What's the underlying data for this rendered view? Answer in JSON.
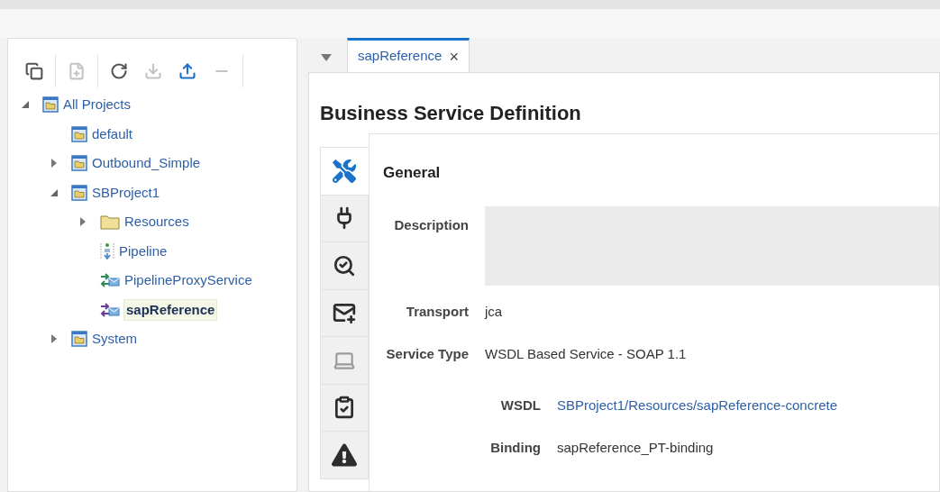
{
  "toolbar": [
    {
      "kind": "collapse-all",
      "disabled": false
    },
    {
      "kind": "new",
      "disabled": true
    },
    {
      "kind": "refresh",
      "disabled": false
    },
    {
      "kind": "import",
      "disabled": true
    },
    {
      "kind": "export",
      "disabled": false
    },
    {
      "kind": "remove",
      "disabled": true
    }
  ],
  "tree": [
    {
      "label": "All Projects",
      "kind": "project",
      "expanded": true,
      "selected": false,
      "children": [
        {
          "label": "default",
          "kind": "project",
          "selected": false
        },
        {
          "label": "Outbound_Simple",
          "kind": "project",
          "expanded": false,
          "selected": false
        },
        {
          "label": "SBProject1",
          "kind": "project",
          "expanded": true,
          "selected": false,
          "children": [
            {
              "label": "Resources",
              "kind": "folder",
              "expanded": false,
              "selected": false
            },
            {
              "label": "Pipeline",
              "kind": "pipeline",
              "selected": false
            },
            {
              "label": "PipelineProxyService",
              "kind": "proxy",
              "selected": false
            },
            {
              "label": "sapReference",
              "kind": "business",
              "selected": true
            }
          ]
        },
        {
          "label": "System",
          "kind": "project",
          "expanded": false,
          "selected": false
        }
      ]
    }
  ],
  "tabs": [
    {
      "label": "sapReference",
      "close": "×",
      "selected": true
    }
  ],
  "title": "Business Service Definition",
  "side_tabs": [
    {
      "kind": "general",
      "selected": true,
      "disabled": false
    },
    {
      "kind": "transport",
      "selected": false,
      "disabled": false
    },
    {
      "kind": "search",
      "selected": false,
      "disabled": false
    },
    {
      "kind": "message",
      "selected": false,
      "disabled": false
    },
    {
      "kind": "monitor",
      "selected": false,
      "disabled": true
    },
    {
      "kind": "policy",
      "selected": false,
      "disabled": false
    },
    {
      "kind": "warning",
      "selected": false,
      "disabled": false
    }
  ],
  "section_title": "General",
  "fields": [
    {
      "label": "Description",
      "kind": "textarea"
    },
    {
      "label": "Transport",
      "kind": "text",
      "value": "jca"
    },
    {
      "label": "Service Type",
      "kind": "text",
      "value": "WSDL Based Service - SOAP 1.1"
    }
  ],
  "sub_fields": [
    {
      "label": "WSDL",
      "kind": "link",
      "value": "SBProject1/Resources/sapReference-concrete"
    },
    {
      "label": "Binding",
      "kind": "text",
      "value": "sapReference_PT-binding"
    }
  ]
}
